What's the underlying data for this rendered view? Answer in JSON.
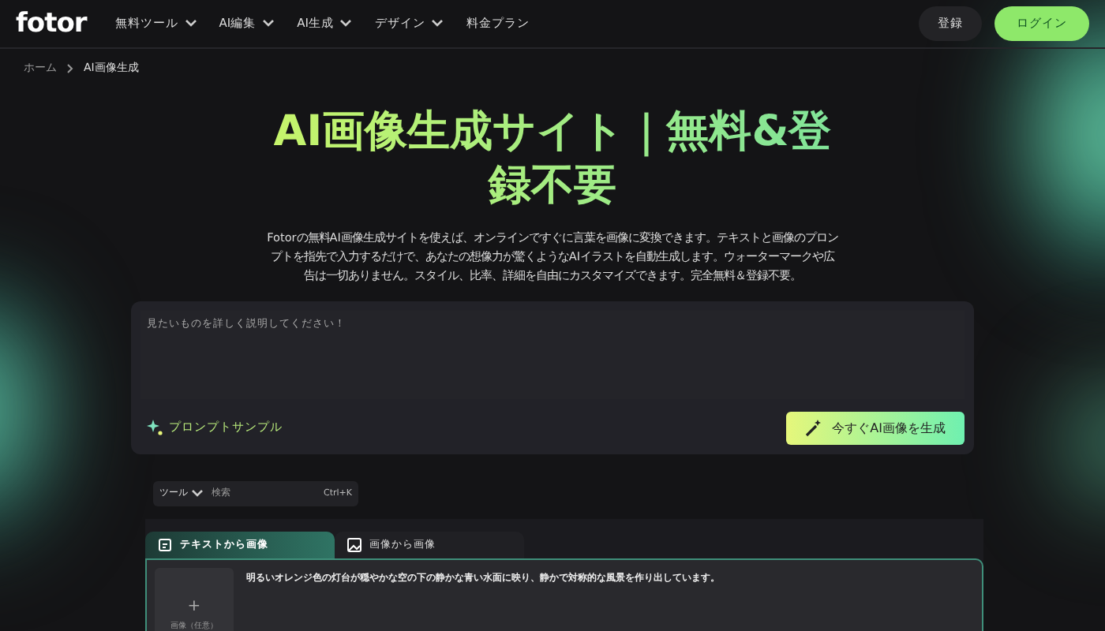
{
  "header": {
    "logo": "fotor",
    "nav": [
      {
        "label": "無料ツール",
        "has_menu": true
      },
      {
        "label": "AI編集",
        "has_menu": true
      },
      {
        "label": "AI生成",
        "has_menu": true
      },
      {
        "label": "デザイン",
        "has_menu": true
      },
      {
        "label": "料金プラン",
        "has_menu": false
      }
    ],
    "signup": "登録",
    "login": "ログイン"
  },
  "breadcrumb": [
    "ホーム",
    "AI画像生成"
  ],
  "title": "AI画像生成サイト｜無料&登録不要",
  "description": "Fotorの無料AI画像生成サイトを使えば、オンラインですぐに言葉を画像に変換できます。テキストと画像のプロンプトを指先で入力するだけで、あなたの想像力が驚くようなAIイラストを自動生成します。ウォーターマークや広告は一切ありません。スタイル、比率、詳細を自由にカスタマイズできます。完全無料＆登録不要。",
  "prompt": {
    "placeholder": "見たいものを詳しく説明してください！",
    "sample": "プロンプトサンプル",
    "generate": "今すぐAI画像を生成"
  },
  "toolbar": {
    "dropdown": "ツール",
    "search_placeholder": "検索",
    "shortcut": "Ctrl+K"
  },
  "tabs": [
    {
      "label": "テキストから画像",
      "selected": true
    },
    {
      "label": "画像から画像",
      "selected": false
    }
  ],
  "editor": {
    "upload": "画像（任意）",
    "upload_icon": "+",
    "value": "明るいオレンジ色の灯台が穏やかな空の下の静かな青い水面に映り、静かで対称的な風景を作り出しています。"
  }
}
